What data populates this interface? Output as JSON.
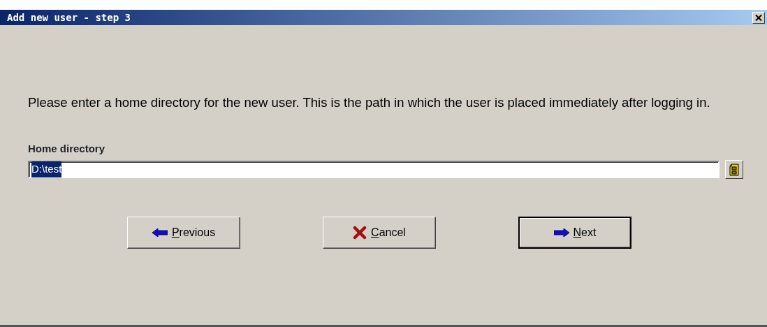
{
  "window": {
    "title": "Add new user - step 3"
  },
  "description": "Please enter a home directory for the new user. This is the path in which the user is placed immediately after logging in.",
  "field": {
    "label": "Home directory",
    "value": "D:\\test",
    "selected": true
  },
  "buttons": [
    {
      "kind": "previous",
      "label": "Previous",
      "mnemonic": true,
      "default": false
    },
    {
      "kind": "cancel",
      "label": "Cancel",
      "mnemonic": true,
      "default": false
    },
    {
      "kind": "next",
      "label": "Next",
      "mnemonic": true,
      "default": true
    }
  ]
}
